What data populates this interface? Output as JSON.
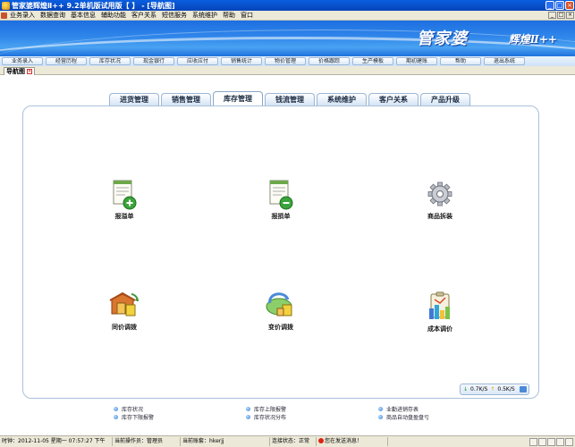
{
  "window": {
    "title": "管家婆辉煌Ⅱ++ 9.2单机版试用版【 】 - [导航图]"
  },
  "menubar": {
    "items": [
      "业务录入",
      "数据查询",
      "基本信息",
      "辅助功能",
      "客户关系",
      "短信服务",
      "系统维护",
      "帮助",
      "窗口"
    ]
  },
  "banner": {
    "brand": "管家婆",
    "brand_sub": "辉煌Ⅱ++"
  },
  "modules": [
    "业务录入",
    "经营历程",
    "库存状况",
    "现金银行",
    "应收应付",
    "销售统计",
    "物价管理",
    "价格跟踪",
    "生产模板",
    "期初建账",
    "帮助",
    "退出系统"
  ],
  "doc_tab": {
    "label": "导航图"
  },
  "tabs": [
    {
      "label": "进货管理",
      "active": false
    },
    {
      "label": "销售管理",
      "active": false
    },
    {
      "label": "库存管理",
      "active": true
    },
    {
      "label": "钱流管理",
      "active": false
    },
    {
      "label": "系统维护",
      "active": false
    },
    {
      "label": "客户关系",
      "active": false
    },
    {
      "label": "产品升级",
      "active": false
    }
  ],
  "icons": [
    {
      "label": "报溢单",
      "icon": "document-add-icon"
    },
    {
      "label": "报损单",
      "icon": "document-remove-icon"
    },
    {
      "label": "商品拆装",
      "icon": "gear-icon"
    },
    {
      "label": "同价调拨",
      "icon": "warehouse-transfer-icon"
    },
    {
      "label": "变价调拨",
      "icon": "price-transfer-icon"
    },
    {
      "label": "成本调价",
      "icon": "cost-chart-icon"
    }
  ],
  "network": {
    "down": "0.7K/S",
    "up": "0.5K/S"
  },
  "quicklinks": {
    "col1": [
      "库存状况",
      "库存下限报警"
    ],
    "col2": [
      "库存上限报警",
      "库存状况分布"
    ],
    "col3": [
      "业勤进销存表",
      "商品自动盘盈盘亏"
    ]
  },
  "statusbar": {
    "clock": "时钟：2012-11-05 星期一 07:57:27 下午",
    "operator": "当前操作员：管理员",
    "account": "当前账套：hkerjj",
    "connection": "连接状态：正常",
    "message": "您在发送消息！"
  }
}
